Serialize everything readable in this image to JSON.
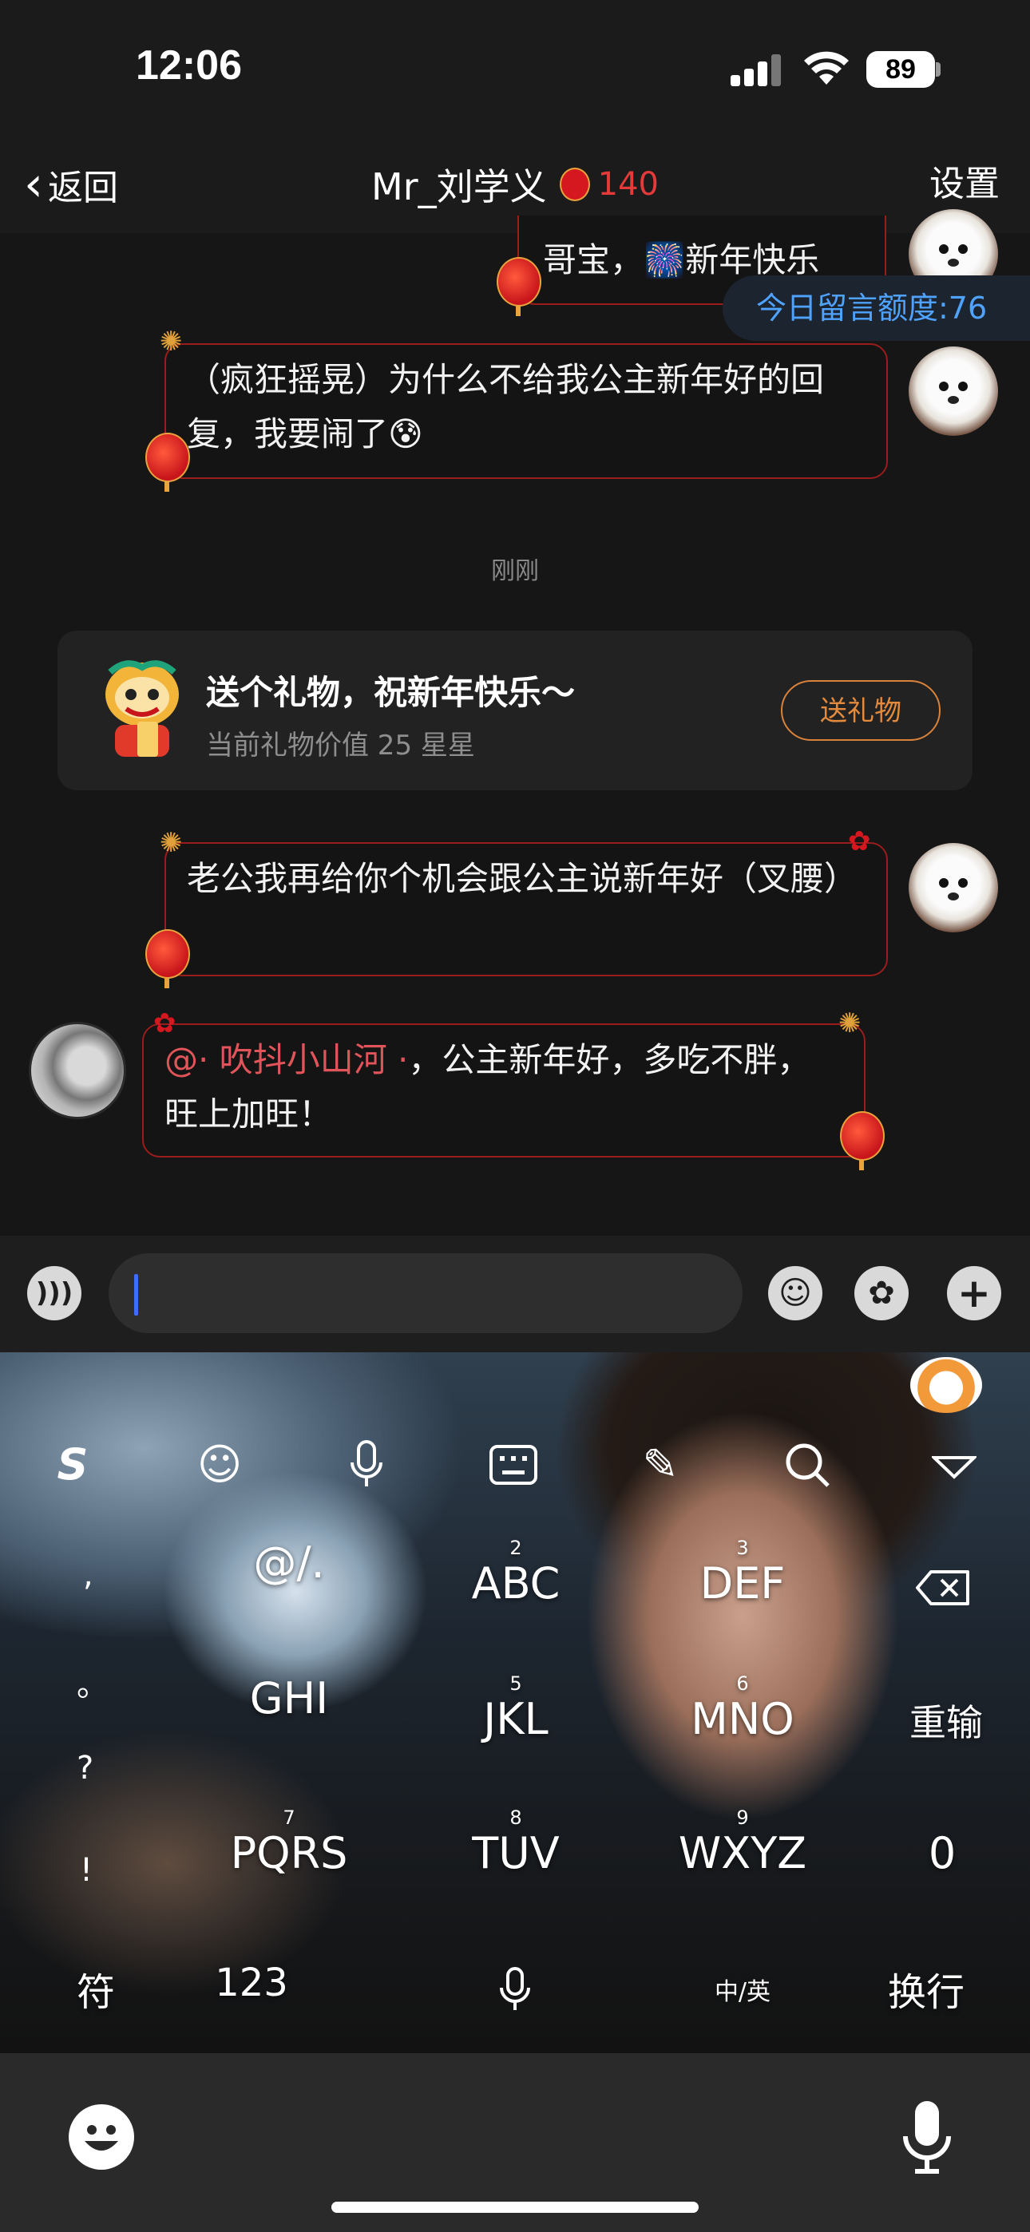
{
  "status_bar": {
    "time": "12:06",
    "battery": "89"
  },
  "nav": {
    "back_label": "返回",
    "title": "Mr_刘学义",
    "heat": "140",
    "settings_label": "设置"
  },
  "chat": {
    "quota_label": "今日留言额度:76",
    "messages": [
      {
        "text": "哥宝，🎆新年快乐"
      },
      {
        "text": "（疯狂摇晃）为什么不给我公主新年好的回复，我要闹了😰"
      },
      {
        "text": "老公我再给你个机会跟公主说新年好（叉腰）"
      },
      {
        "mention": "@· 吹抖小山河 ·",
        "text": "，公主新年好，多吃不胖，旺上加旺！"
      }
    ],
    "time_label": "刚刚",
    "gift_card": {
      "title": "送个礼物，祝新年快乐～",
      "subtitle": "当前礼物价值 25 星星",
      "button_label": "送礼物"
    }
  },
  "input_bar": {
    "placeholder": ""
  },
  "keyboard": {
    "toolbar_icons": [
      "sogou-logo-icon",
      "emoji-icon",
      "microphone-icon",
      "keyboard-icon",
      "handwriting-icon",
      "search-icon",
      "collapse-icon"
    ],
    "row1": [
      {
        "num": "",
        "label": "@/."
      },
      {
        "num": "2",
        "label": "ABC"
      },
      {
        "num": "3",
        "label": "DEF"
      }
    ],
    "row2": [
      {
        "num": "",
        "label": "GHI"
      },
      {
        "num": "5",
        "label": "JKL"
      },
      {
        "num": "6",
        "label": "MNO"
      }
    ],
    "row3": [
      {
        "num": "7",
        "label": "PQRS"
      },
      {
        "num": "8",
        "label": "TUV"
      },
      {
        "num": "9",
        "label": "WXYZ"
      }
    ],
    "punct": [
      ",",
      "。",
      "?",
      "!"
    ],
    "reinput": "重输",
    "zero": "0",
    "symbol": "符",
    "numbers": "123",
    "lang": "中/英",
    "newline": "换行"
  }
}
